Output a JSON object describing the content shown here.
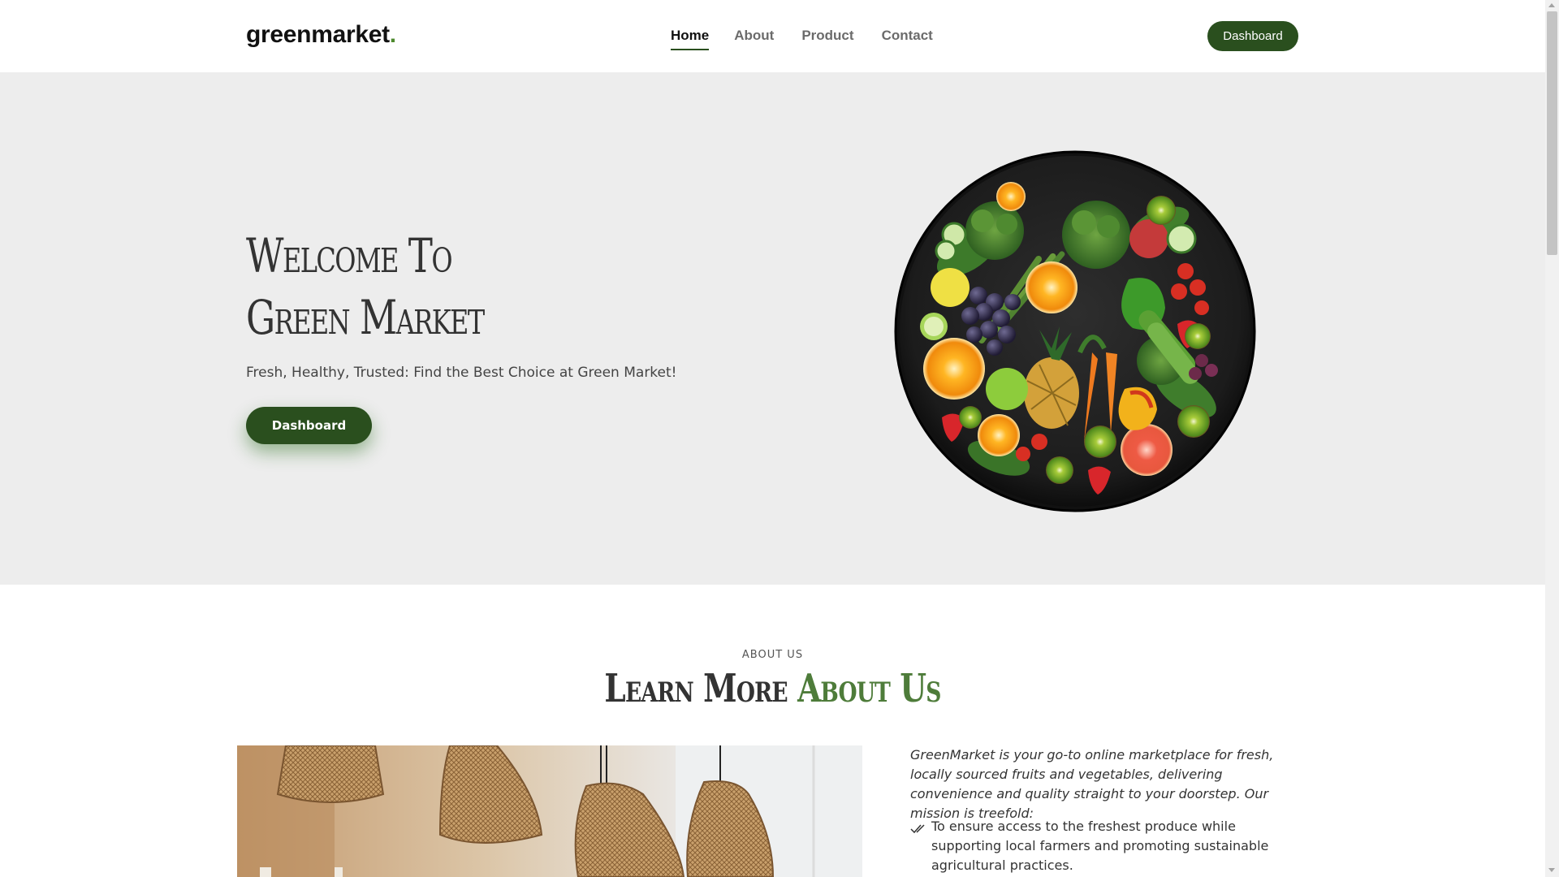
{
  "header": {
    "logo_text": "greenmarket",
    "logo_dot": ".",
    "nav": [
      "Home",
      "About",
      "Product",
      "Contact"
    ],
    "active_nav": "Home",
    "dashboard_label": "Dashboard"
  },
  "hero": {
    "title_line1": "Welcome To",
    "title_line2": "Green Market",
    "subtitle": "Fresh, Healthy, Trusted: Find the Best Choice at Green Market!",
    "button_label": "Dashboard"
  },
  "about": {
    "eyebrow": "ABOUT US",
    "title_part1": "Learn More",
    "title_part2": "About Us",
    "intro": "GreenMarket is your go-to online marketplace for fresh, locally sourced fruits and vegetables, delivering convenience and quality straight to your doorstep. Our mission is treefold:",
    "points": [
      "To ensure access to the freshest produce while supporting local farmers and promoting sustainable agricultural practices."
    ]
  },
  "colors": {
    "brand_green": "#2a4f1e",
    "accent_green": "#4e7c3a",
    "hero_bg": "#ededed"
  }
}
